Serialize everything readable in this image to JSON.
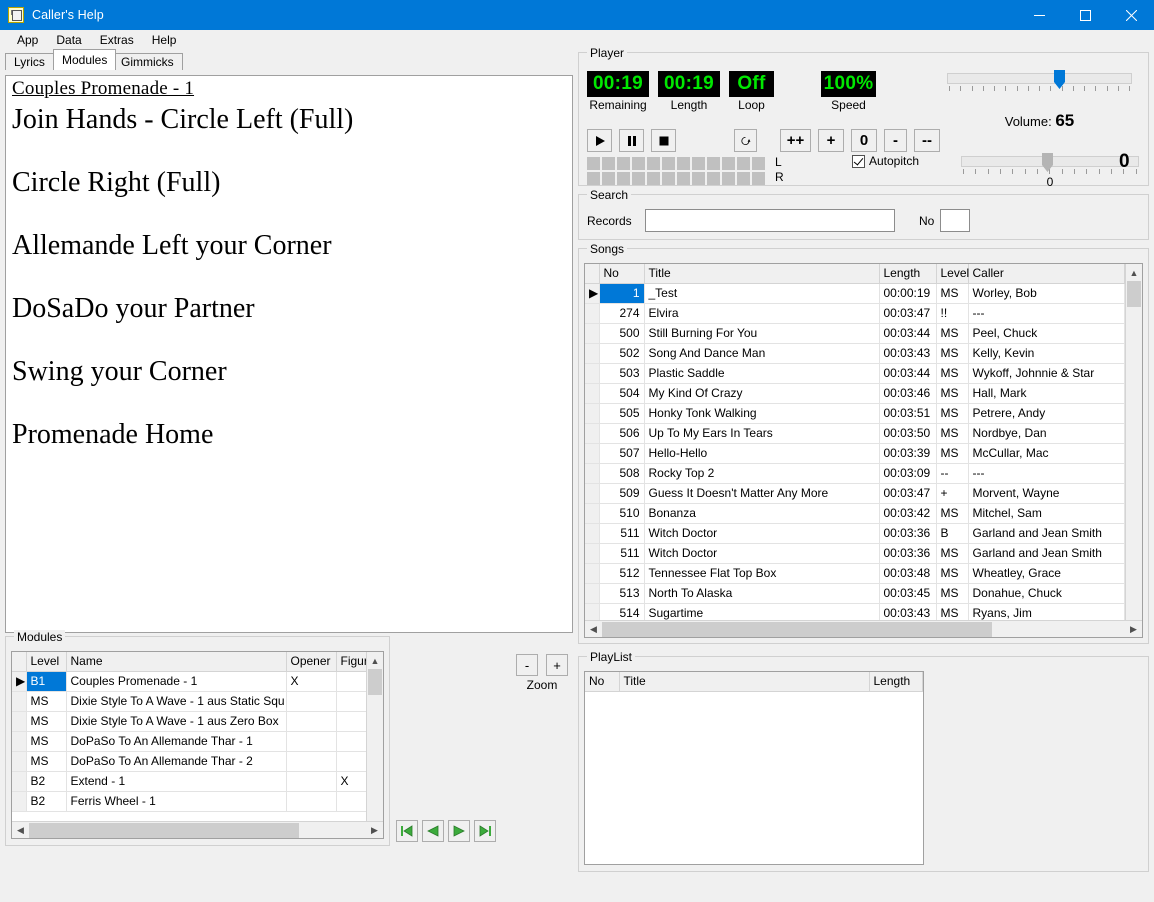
{
  "window": {
    "title": "Caller's Help",
    "icon": "app-icon",
    "minimize": "minimize-icon",
    "maximize": "maximize-icon",
    "close": "close-icon"
  },
  "menu": [
    "App",
    "Data",
    "Extras",
    "Help"
  ],
  "tabs": [
    {
      "label": "Lyrics",
      "active": false
    },
    {
      "label": "Modules",
      "active": true
    },
    {
      "label": "Gimmicks",
      "active": false
    }
  ],
  "lyrics": {
    "title": "Couples Promenade - 1",
    "lines": [
      "Join Hands - Circle Left (Full)",
      "Circle Right (Full)",
      "Allemande Left your Corner",
      "DoSaDo your Partner",
      "Swing your Corner",
      "Promenade Home"
    ]
  },
  "player": {
    "legend": "Player",
    "displays": [
      {
        "value": "00:19",
        "label": "Remaining"
      },
      {
        "value": "00:19",
        "label": "Length"
      },
      {
        "value": "Off",
        "label": "Loop"
      },
      {
        "value": "100%",
        "label": "Speed"
      }
    ],
    "lcd_color": "#00e800",
    "lcd_bg": "#000000",
    "transport": [
      {
        "name": "play-button",
        "glyph": "▶"
      },
      {
        "name": "pause-button",
        "glyph": "❙❙"
      },
      {
        "name": "stop-button",
        "glyph": "■"
      }
    ],
    "loop_button": "↻",
    "speed_buttons": [
      "++",
      "+",
      "0",
      "-",
      "--"
    ],
    "vu_channels": [
      "L",
      "R"
    ],
    "vu_segments": 12,
    "autopitch": {
      "label": "Autopitch",
      "checked": true
    },
    "volume": {
      "label": "Volume:",
      "value": "65",
      "percent": 65
    },
    "pitch": {
      "value": "0",
      "scale_label": "0",
      "percent": 48
    }
  },
  "search": {
    "legend": "Search",
    "records_label": "Records",
    "records_value": "",
    "no_label": "No",
    "no_value": ""
  },
  "songs": {
    "legend": "Songs",
    "columns": [
      "No",
      "Title",
      "Length",
      "Level",
      "Caller"
    ],
    "rows": [
      {
        "no": "1",
        "title": "_Test",
        "length": "00:00:19",
        "level": "MS",
        "caller": "Worley, Bob",
        "selected": true
      },
      {
        "no": "274",
        "title": "Elvira",
        "length": "00:03:47",
        "level": "!!",
        "caller": "---",
        "selected": false
      },
      {
        "no": "500",
        "title": "Still Burning For You",
        "length": "00:03:44",
        "level": "MS",
        "caller": "Peel, Chuck",
        "selected": false
      },
      {
        "no": "502",
        "title": "Song And Dance Man",
        "length": "00:03:43",
        "level": "MS",
        "caller": "Kelly, Kevin",
        "selected": false
      },
      {
        "no": "503",
        "title": "Plastic Saddle",
        "length": "00:03:44",
        "level": "MS",
        "caller": "Wykoff, Johnnie & Star",
        "selected": false
      },
      {
        "no": "504",
        "title": "My Kind Of Crazy",
        "length": "00:03:46",
        "level": "MS",
        "caller": "Hall, Mark",
        "selected": false
      },
      {
        "no": "505",
        "title": "Honky Tonk Walking",
        "length": "00:03:51",
        "level": "MS",
        "caller": "Petrere, Andy",
        "selected": false
      },
      {
        "no": "506",
        "title": "Up To My Ears In Tears",
        "length": "00:03:50",
        "level": "MS",
        "caller": "Nordbye, Dan",
        "selected": false
      },
      {
        "no": "507",
        "title": "Hello-Hello",
        "length": "00:03:39",
        "level": "MS",
        "caller": "McCullar, Mac",
        "selected": false
      },
      {
        "no": "508",
        "title": "Rocky Top 2",
        "length": "00:03:09",
        "level": "--",
        "caller": "---",
        "selected": false
      },
      {
        "no": "509",
        "title": "Guess It Doesn't Matter Any More",
        "length": "00:03:47",
        "level": "+",
        "caller": "Morvent, Wayne",
        "selected": false
      },
      {
        "no": "510",
        "title": "Bonanza",
        "length": "00:03:42",
        "level": "MS",
        "caller": "Mitchel, Sam",
        "selected": false
      },
      {
        "no": "511",
        "title": "Witch Doctor",
        "length": "00:03:36",
        "level": "B",
        "caller": "Garland and Jean Smith",
        "selected": false
      },
      {
        "no": "511",
        "title": "Witch Doctor",
        "length": "00:03:36",
        "level": "MS",
        "caller": "Garland and Jean Smith",
        "selected": false
      },
      {
        "no": "512",
        "title": "Tennessee Flat Top Box",
        "length": "00:03:48",
        "level": "MS",
        "caller": "Wheatley, Grace",
        "selected": false
      },
      {
        "no": "513",
        "title": "North To Alaska",
        "length": "00:03:45",
        "level": "MS",
        "caller": "Donahue, Chuck",
        "selected": false
      },
      {
        "no": "514",
        "title": "Sugartime",
        "length": "00:03:43",
        "level": "MS",
        "caller": "Ryans, Jim",
        "selected": false
      }
    ]
  },
  "modules": {
    "legend": "Modules",
    "columns": [
      "Level",
      "Name",
      "Opener",
      "Figure"
    ],
    "rows": [
      {
        "level": "B1",
        "name": "Couples Promenade - 1",
        "opener": "X",
        "figure": "",
        "selected": true
      },
      {
        "level": "MS",
        "name": "Dixie Style To A Wave - 1 aus Static Squ",
        "opener": "",
        "figure": "",
        "selected": false
      },
      {
        "level": "MS",
        "name": "Dixie Style To A Wave - 1 aus Zero Box",
        "opener": "",
        "figure": "",
        "selected": false
      },
      {
        "level": "MS",
        "name": "DoPaSo To An Allemande Thar - 1",
        "opener": "",
        "figure": "",
        "selected": false
      },
      {
        "level": "MS",
        "name": "DoPaSo To An Allemande Thar - 2",
        "opener": "",
        "figure": "",
        "selected": false
      },
      {
        "level": "B2",
        "name": "Extend - 1",
        "opener": "",
        "figure": "X",
        "selected": false
      },
      {
        "level": "B2",
        "name": "Ferris Wheel - 1",
        "opener": "",
        "figure": "",
        "selected": false
      }
    ]
  },
  "zoom_controls": {
    "minus": "-",
    "plus": "+",
    "label": "Zoom"
  },
  "nav_buttons": [
    {
      "name": "first-record-button",
      "glyph": "first"
    },
    {
      "name": "previous-record-button",
      "glyph": "prev"
    },
    {
      "name": "next-record-button",
      "glyph": "next"
    },
    {
      "name": "last-record-button",
      "glyph": "last"
    }
  ],
  "playlist": {
    "legend": "PlayList",
    "columns": [
      "No",
      "Title",
      "Length"
    ],
    "rows": []
  },
  "colors": {
    "accent": "#0078d7",
    "lcd_green": "#00e800",
    "nav_green": "#3cab3c",
    "window_bg": "#f0f0f0"
  }
}
